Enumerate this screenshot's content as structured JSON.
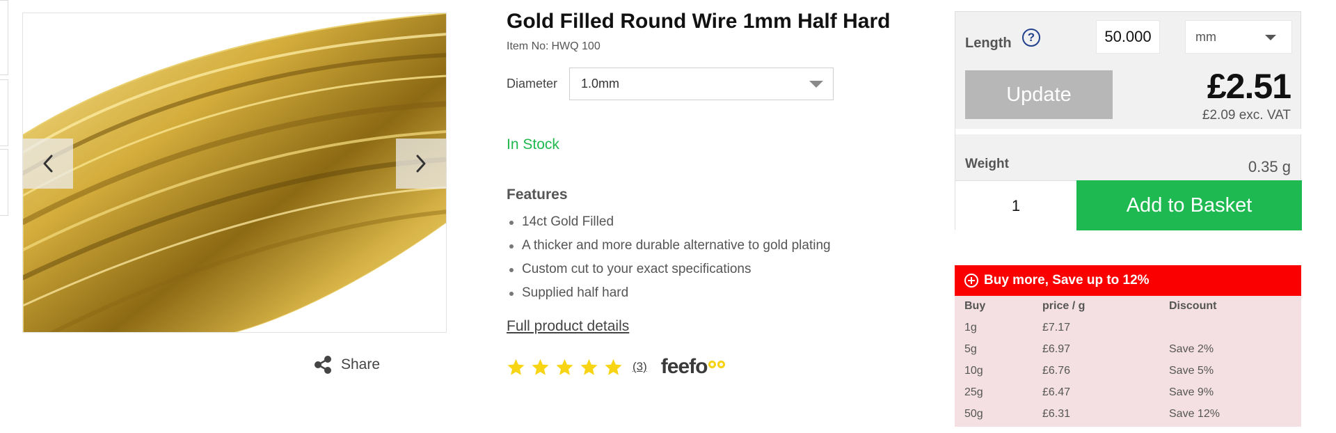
{
  "product": {
    "title": "Gold Filled Round Wire 1mm Half Hard",
    "item_no_label": "Item No:",
    "item_no": "HWQ 100",
    "diameter_label": "Diameter",
    "diameter_value": "1.0mm",
    "stock_status": "In Stock",
    "features_title": "Features",
    "features": [
      "14ct Gold Filled",
      "A thicker and more durable alternative to gold plating",
      "Custom cut to your exact specifications",
      "Supplied half hard"
    ],
    "full_details_link": "Full product details",
    "rating": {
      "stars": 5,
      "review_count": "(3)",
      "provider": "feefo"
    }
  },
  "gallery": {
    "share_label": "Share",
    "colors": {
      "gold_light": "#f3dc7a",
      "gold_mid": "#c9a233",
      "gold_dark": "#7a5a10"
    }
  },
  "purchase": {
    "length_label": "Length",
    "length_value": "50.000",
    "unit": "mm",
    "update_label": "Update",
    "price": "£2.51",
    "price_ex_vat": "£2.09 exc. VAT",
    "weight_label": "Weight",
    "weight_value": "0.35 g",
    "quantity": "1",
    "basket_label": "Add to Basket"
  },
  "discount": {
    "heading": "Buy more, Save up to 12%",
    "columns": [
      "Buy",
      "price / g",
      "Discount"
    ],
    "rows": [
      [
        "1g",
        "£7.17",
        ""
      ],
      [
        "5g",
        "£6.97",
        "Save 2%"
      ],
      [
        "10g",
        "£6.76",
        "Save 5%"
      ],
      [
        "25g",
        "£6.47",
        "Save 9%"
      ],
      [
        "50g",
        "£6.31",
        "Save 12%"
      ]
    ]
  },
  "colors": {
    "in_stock": "#1eb84c",
    "basket_button": "#1fb951",
    "update_button": "#b7b7b7",
    "discount_header": "#fb0000",
    "discount_body": "#f4e0e2",
    "star": "#f7d515",
    "help_icon": "#22418c"
  }
}
